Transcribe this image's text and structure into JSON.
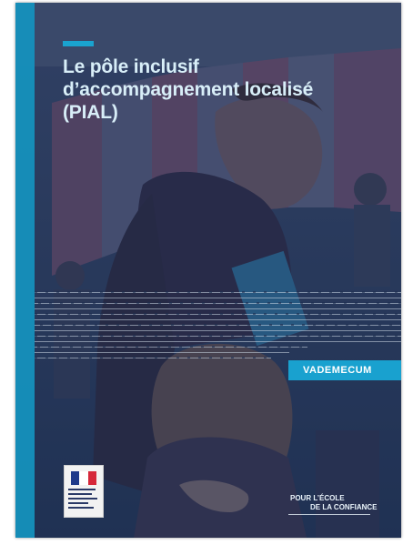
{
  "cover": {
    "title": "Le pôle inclusif\nd’accompagnement localisé\n(PIAL)",
    "badge": "VADEMECUM",
    "tagline_line1": "POUR L’ÉCOLE",
    "tagline_line2": "DE LA CONFIANCE",
    "accent_color": "#1aa3cf",
    "overlay_color": "#2c3f63"
  },
  "logo": {
    "icon": "marianne-logo",
    "label": "Ministère de l’Éducation nationale et de la Jeunesse"
  }
}
